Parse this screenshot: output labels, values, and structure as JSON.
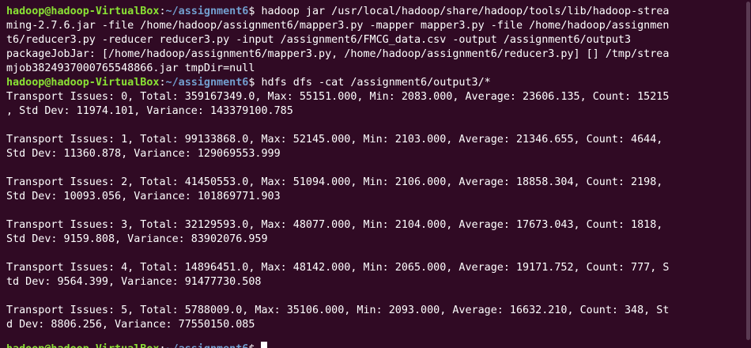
{
  "prompt": {
    "user_host": "hadoop@hadoop-VirtualBox",
    "colon": ":",
    "cwd": "~/assignment6",
    "dollar": "$ "
  },
  "commands": [
    {
      "command_lines": [
        "hadoop jar /usr/local/hadoop/share/hadoop/tools/lib/hadoop-strea",
        "ming-2.7.6.jar -file /home/hadoop/assignment6/mapper3.py -mapper mapper3.py -file /home/hadoop/assignmen",
        "t6/reducer3.py -reducer reducer3.py -input /assignment6/FMCG_data.csv -output /assignment6/output3"
      ],
      "output_lines": [
        "packageJobJar: [/home/hadoop/assignment6/mapper3.py, /home/hadoop/assignment6/reducer3.py] [] /tmp/strea",
        "mjob3824937000765548866.jar tmpDir=null"
      ]
    },
    {
      "command_lines": [
        "hdfs dfs -cat /assignment6/output3/*"
      ],
      "output_lines": [
        "Transport Issues: 0, Total: 359167349.0, Max: 55151.000, Min: 2083.000, Average: 23606.135, Count: 15215",
        ", Std Dev: 11974.101, Variance: 143379100.785",
        "",
        "Transport Issues: 1, Total: 99133868.0, Max: 52145.000, Min: 2103.000, Average: 21346.655, Count: 4644,",
        "Std Dev: 11360.878, Variance: 129069553.999",
        "",
        "Transport Issues: 2, Total: 41450553.0, Max: 51094.000, Min: 2106.000, Average: 18858.304, Count: 2198,",
        "Std Dev: 10093.056, Variance: 101869771.903",
        "",
        "Transport Issues: 3, Total: 32129593.0, Max: 48077.000, Min: 2104.000, Average: 17673.043, Count: 1818,",
        "Std Dev: 9159.808, Variance: 83902076.959",
        "",
        "Transport Issues: 4, Total: 14896451.0, Max: 48142.000, Min: 2065.000, Average: 19171.752, Count: 777, S",
        "td Dev: 9564.399, Variance: 91477730.508",
        "",
        "Transport Issues: 5, Total: 5788009.0, Max: 35106.000, Min: 2093.000, Average: 16632.210, Count: 348, St",
        "d Dev: 8806.256, Variance: 77550150.085",
        ""
      ]
    }
  ],
  "colors": {
    "background": "#300a24",
    "user_host": "#8ae234",
    "cwd": "#729fcf",
    "text": "#ffffff"
  }
}
